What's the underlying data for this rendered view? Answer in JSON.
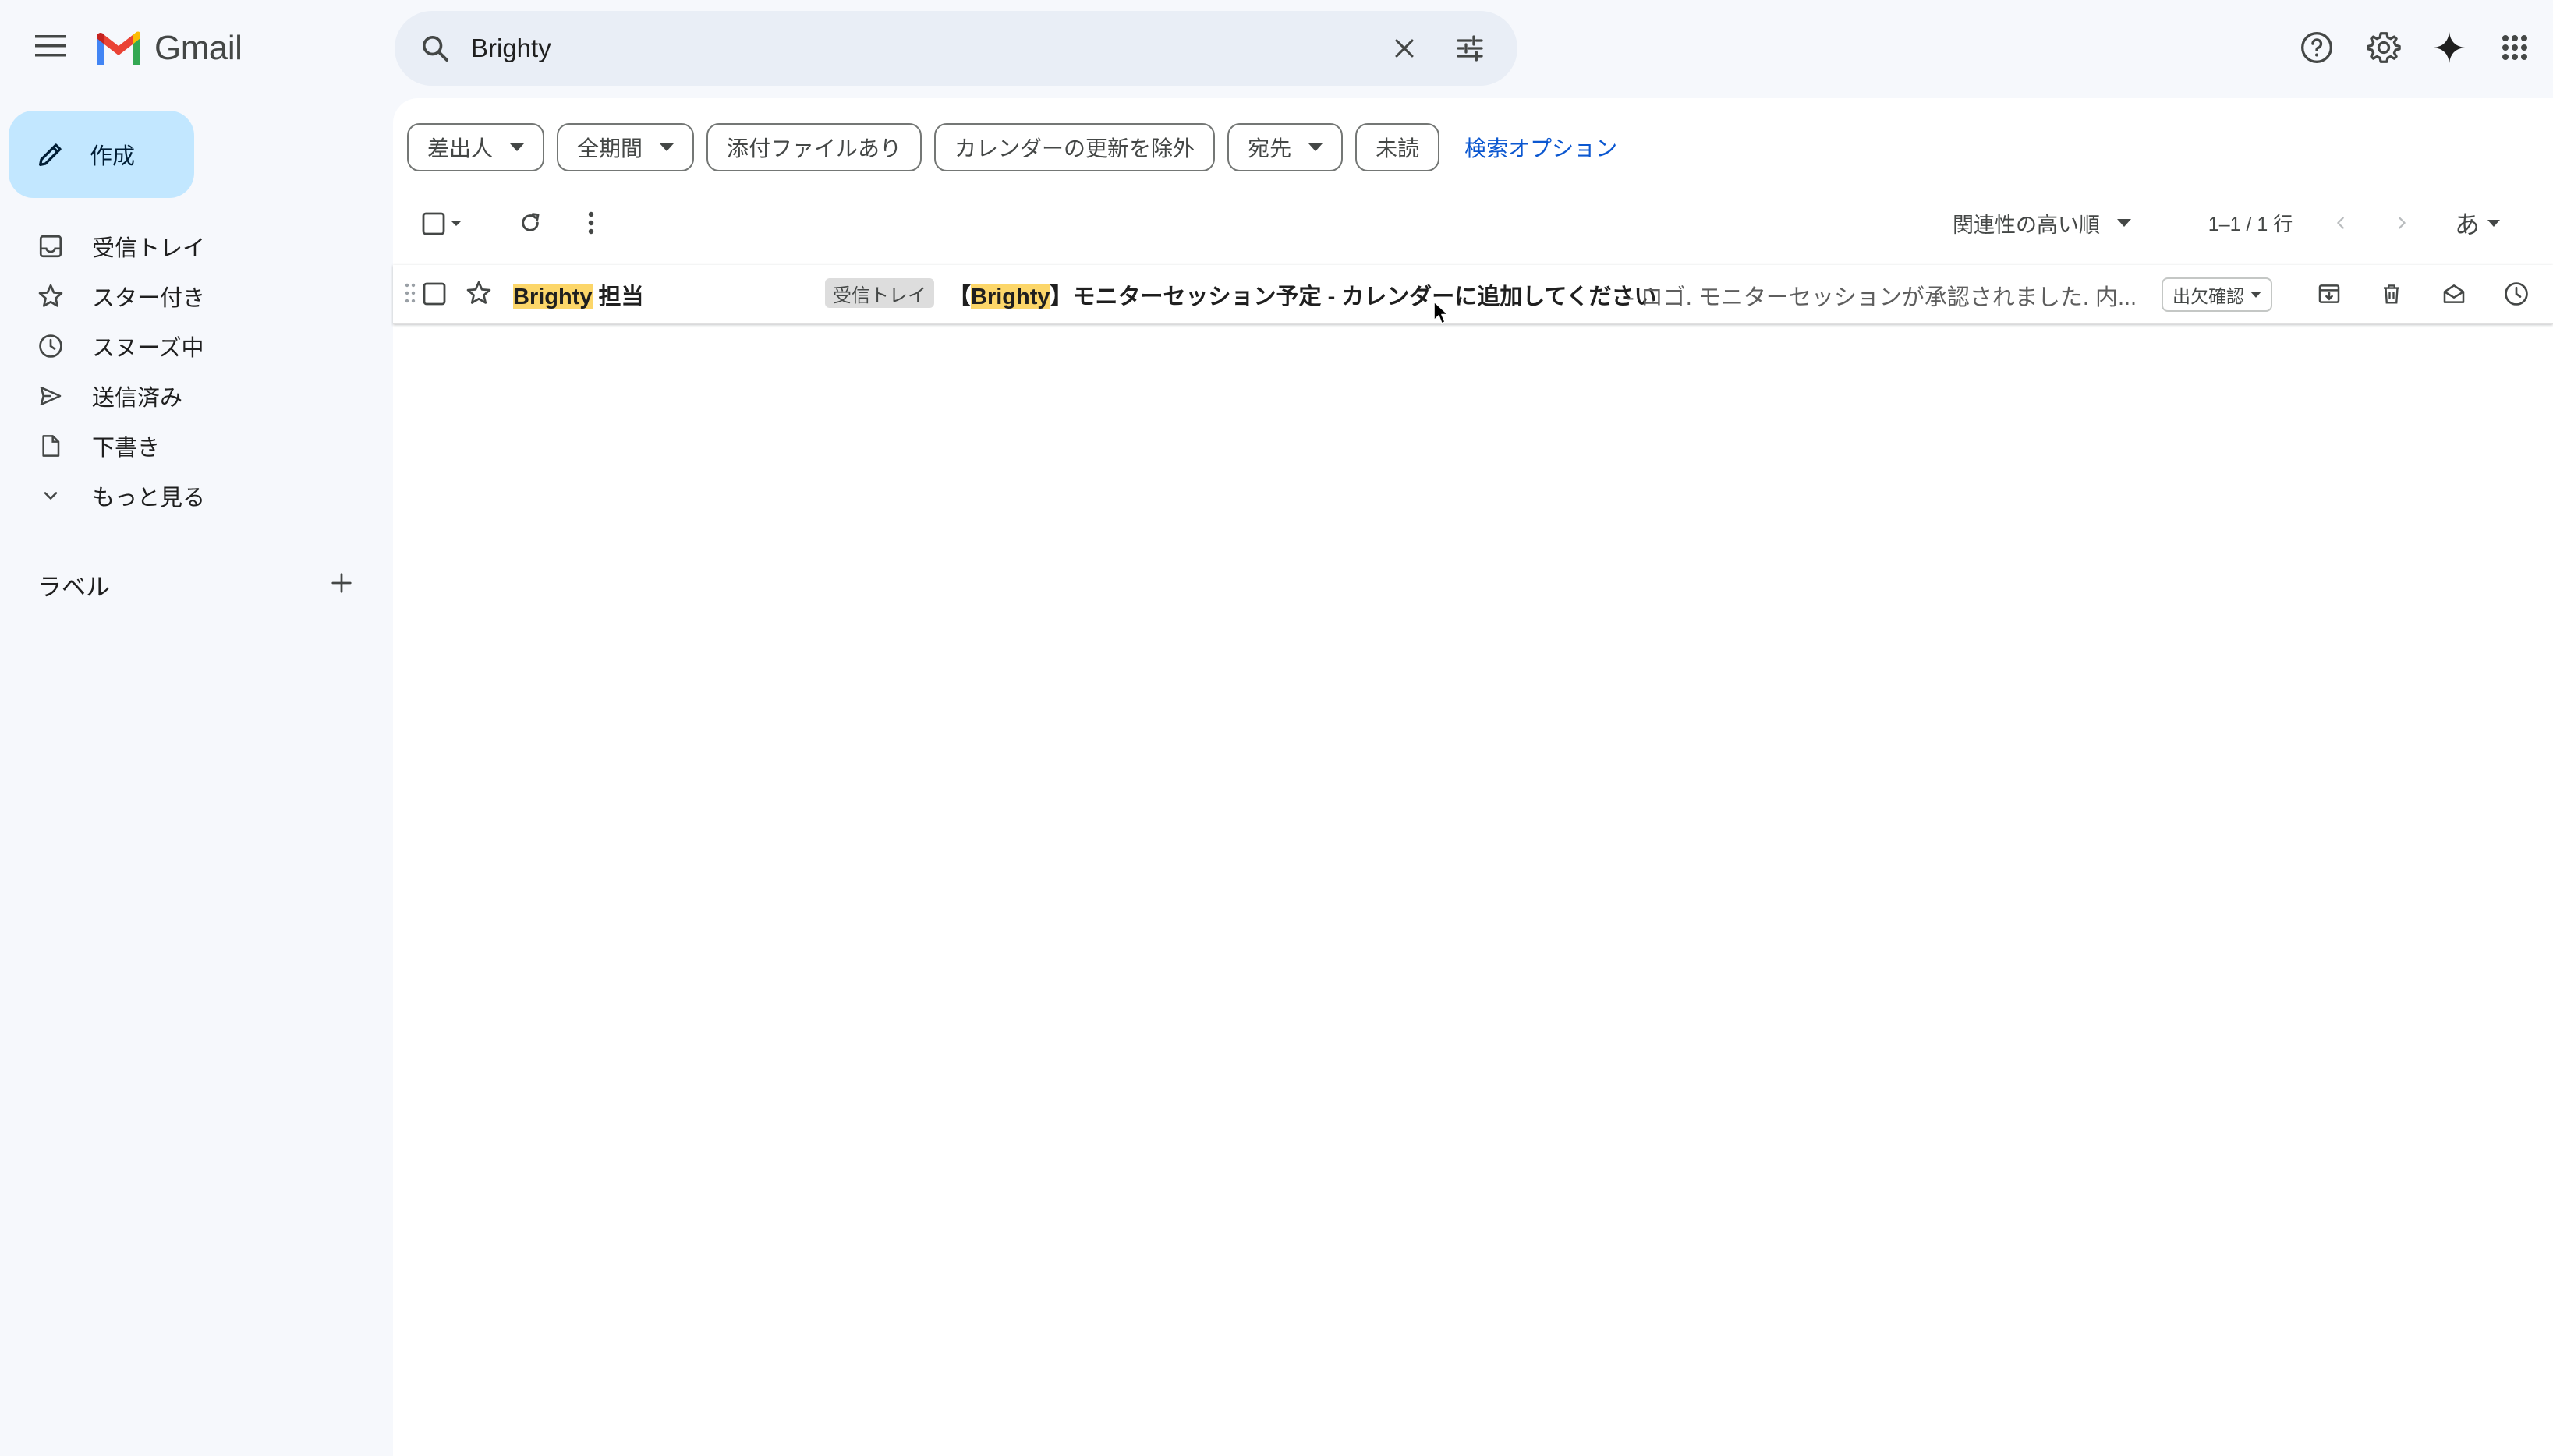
{
  "app": {
    "name": "Gmail"
  },
  "search": {
    "value": "Brighty"
  },
  "compose": {
    "label": "作成"
  },
  "sidebar": {
    "items": [
      {
        "label": "受信トレイ",
        "icon": "inbox-icon"
      },
      {
        "label": "スター付き",
        "icon": "star-icon"
      },
      {
        "label": "スヌーズ中",
        "icon": "clock-icon"
      },
      {
        "label": "送信済み",
        "icon": "send-icon"
      },
      {
        "label": "下書き",
        "icon": "draft-icon"
      },
      {
        "label": "もっと見る",
        "icon": "chevron-down-icon"
      }
    ],
    "labels_title": "ラベル"
  },
  "filters": {
    "from": "差出人",
    "time": "全期間",
    "attachment": "添付ファイルあり",
    "exclude_calendar": "カレンダーの更新を除外",
    "to": "宛先",
    "unread": "未読",
    "advanced": "検索オプション"
  },
  "toolbar": {
    "sort": "関連性の高い順",
    "pagination": "1–1 / 1 行",
    "input_tool": "あ"
  },
  "email": {
    "sender_highlight": "Brighty",
    "sender_rest": " 担当",
    "tag": "受信トレイ",
    "subject_prefix": "【",
    "subject_highlight": "Brighty",
    "subject_rest": "】モニターセッション予定 - カレンダーに追加してください",
    "snippet": " - ロゴ. モニターセッションが承認されました. 内...",
    "rsvp": "出欠確認"
  },
  "colors": {
    "background": "#f6f8fc",
    "compose_bg": "#c2e7ff",
    "search_bg": "#e9eef6",
    "link": "#0b57d0",
    "highlight": "#fcd669"
  }
}
